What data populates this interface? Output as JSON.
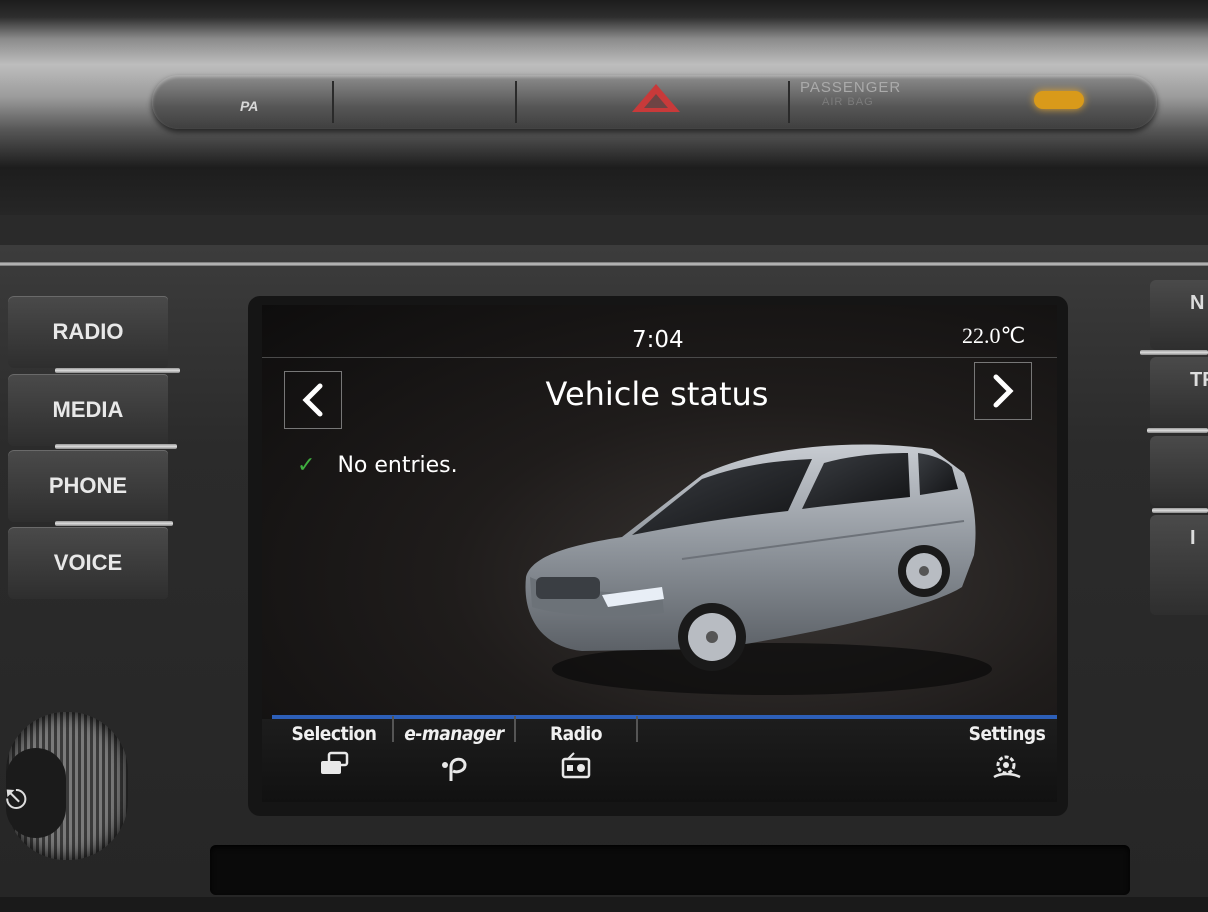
{
  "dashboard": {
    "pa_label": "PA",
    "airbag_label_line1": "PASSENGER",
    "airbag_label_line2": "AIR BAG",
    "airbag_led_color": "#d99a1a",
    "hazard_color": "#c83a3a"
  },
  "hardware_buttons": {
    "left": [
      "RADIO",
      "MEDIA",
      "PHONE",
      "VOICE"
    ],
    "right": [
      "N",
      "TR",
      "",
      "I"
    ]
  },
  "status_bar": {
    "time": "7:04",
    "temperature": "22.0℃"
  },
  "header": {
    "title": "Vehicle status",
    "prev_icon": "chevron-left-icon",
    "next_icon": "chevron-right-icon"
  },
  "message": {
    "icon": "checkmark-icon",
    "text": "No entries."
  },
  "tabs": [
    {
      "label": "Selection",
      "icon": "cards-icon"
    },
    {
      "label": "e-manager",
      "icon": "e-manager-icon"
    },
    {
      "label": "Radio",
      "icon": "radio-icon"
    },
    {
      "label": "Settings",
      "icon": "settings-gear-icon"
    }
  ],
  "colors": {
    "accent_blue": "#2d5fb8",
    "check_green": "#3fae3f"
  }
}
